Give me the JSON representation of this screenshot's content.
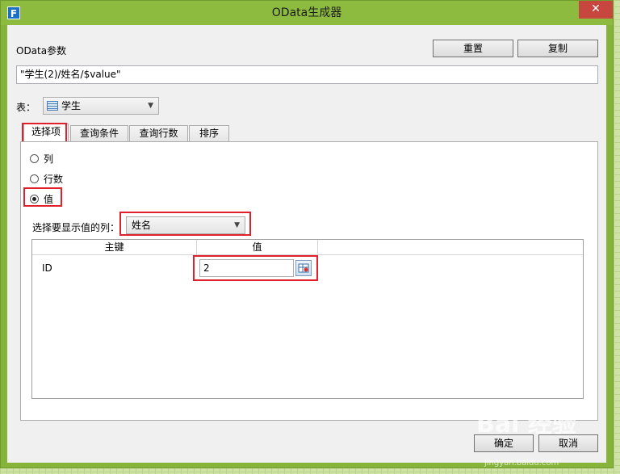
{
  "window": {
    "title": "OData生成器",
    "app_icon_letter": "F",
    "close_glyph": "✕"
  },
  "params": {
    "label": "OData参数",
    "reset_label": "重置",
    "copy_label": "复制",
    "value": "\"学生(2)/姓名/$value\""
  },
  "table": {
    "label": "表：",
    "selected": "学生"
  },
  "tabs": [
    {
      "label": "选择项",
      "active": true
    },
    {
      "label": "查询条件",
      "active": false
    },
    {
      "label": "查询行数",
      "active": false
    },
    {
      "label": "排序",
      "active": false
    }
  ],
  "options": {
    "column": "列",
    "row_count": "行数",
    "value": "值",
    "selected": "值"
  },
  "value_column": {
    "label": "选择要显示值的列：",
    "selected": "姓名"
  },
  "grid": {
    "headers": [
      "主键",
      "值"
    ],
    "rows": [
      {
        "key": "ID",
        "value": "2"
      }
    ]
  },
  "footer": {
    "ok_label": "确定",
    "cancel_label": "取消"
  },
  "watermark": {
    "text": "Bai 经验",
    "sub": "jingyan.baidu.com"
  },
  "colors": {
    "titlebar": "#8dbb3f",
    "highlight": "#e0202a",
    "close": "#c7463d"
  }
}
